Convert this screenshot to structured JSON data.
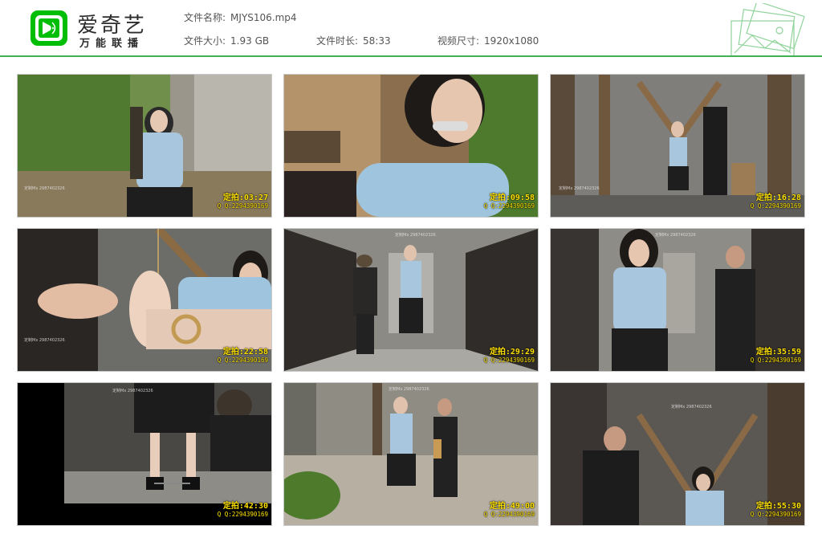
{
  "app": {
    "brand_name": "爱奇艺",
    "brand_sub": "万能联播"
  },
  "file_info": {
    "name_label": "文件名称:",
    "name_value": "MJYS106.mp4",
    "size_label": "文件大小:",
    "size_value": "1.93 GB",
    "duration_label": "文件时长:",
    "duration_value": "58:33",
    "resolution_label": "视频尺寸:",
    "resolution_value": "1920x1080"
  },
  "colors": {
    "accent": "#3fb34f",
    "timestamp": "#ffe100"
  },
  "thumbnails": [
    {
      "label": "定拍:",
      "time": "03:27",
      "contact": "Q Q:2294390169",
      "scene": "forest-wall"
    },
    {
      "label": "定拍:",
      "time": "09:58",
      "contact": "Q Q:2294390169",
      "scene": "forest-closeup"
    },
    {
      "label": "定拍:",
      "time": "16:28",
      "contact": "Q Q:2294390169",
      "scene": "cell-x-frame"
    },
    {
      "label": "定拍:",
      "time": "22:58",
      "contact": "Q Q:2294390169",
      "scene": "cell-feet"
    },
    {
      "label": "定拍:",
      "time": "29:29",
      "contact": "Q Q:2294390169",
      "scene": "corridor"
    },
    {
      "label": "定拍:",
      "time": "35:59",
      "contact": "Q Q:2294390169",
      "scene": "corridor-close"
    },
    {
      "label": "定拍:",
      "time": "42:30",
      "contact": "Q Q:2294390169",
      "scene": "shackles"
    },
    {
      "label": "定拍:",
      "time": "49:00",
      "contact": "Q Q:2294390169",
      "scene": "courtyard"
    },
    {
      "label": "定拍:",
      "time": "55:30",
      "contact": "Q Q:2294390169",
      "scene": "cell-x-frame-dark"
    }
  ]
}
